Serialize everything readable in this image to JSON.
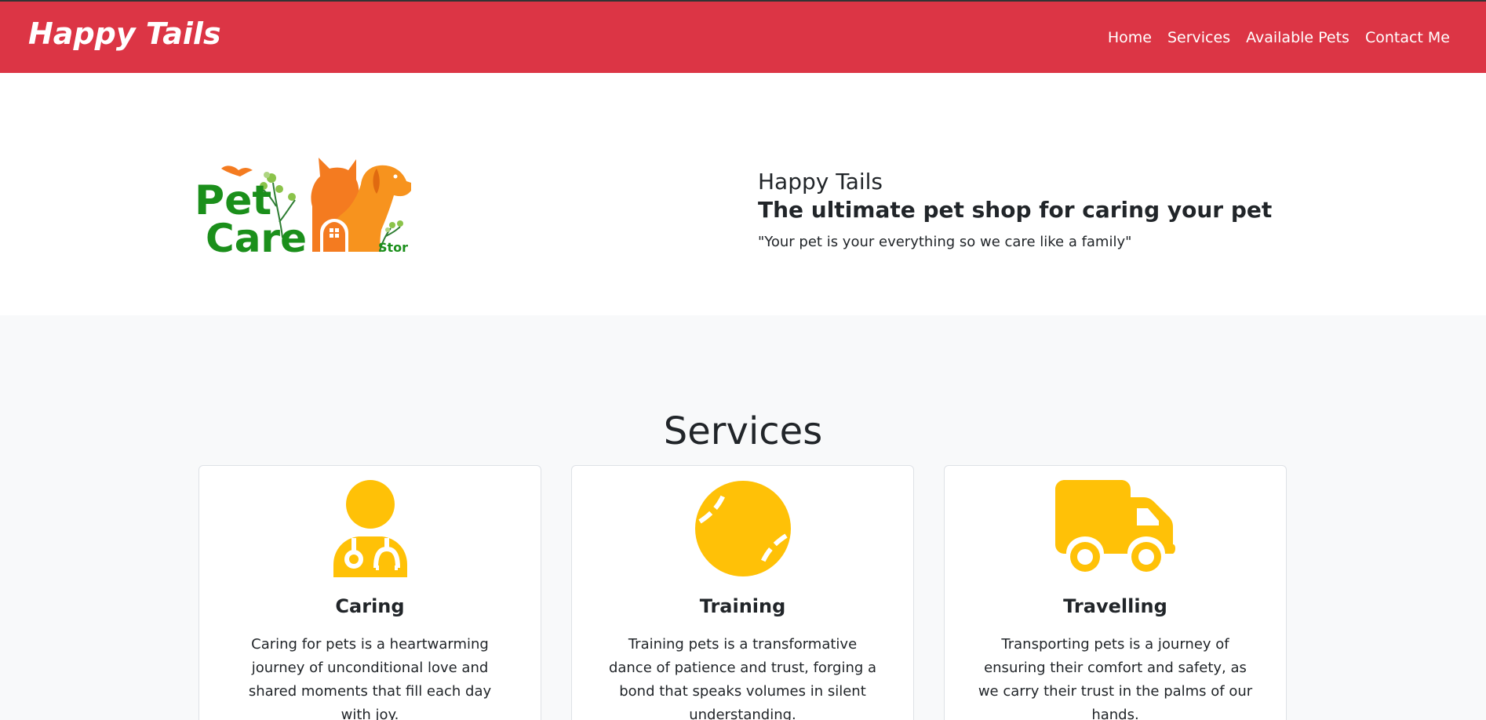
{
  "navbar": {
    "brand": "Happy Tails",
    "links": [
      "Home",
      "Services",
      "Available Pets",
      "Contact Me"
    ],
    "color": "#dc3545"
  },
  "hero": {
    "logo": {
      "line1": "Pet",
      "line2": "Care",
      "suffix": "Stor"
    },
    "title": "Happy Tails",
    "subtitle": "The ultimate pet shop for caring your pet",
    "quote": "\"Your pet is your everything so we care like a family\""
  },
  "services": {
    "heading": "Services",
    "icon_color": "#ffc107",
    "cards": [
      {
        "icon": "doctor-stethoscope-icon",
        "title": "Caring",
        "text": "Caring for pets is a heartwarming journey of unconditional love and shared moments that fill each day with joy."
      },
      {
        "icon": "ball-icon",
        "title": "Training",
        "text": "Training pets is a transformative dance of patience and trust, forging a bond that speaks volumes in silent understanding."
      },
      {
        "icon": "truck-icon",
        "title": "Travelling",
        "text": "Transporting pets is a journey of ensuring their comfort and safety, as we carry their trust in the palms of our hands."
      }
    ]
  }
}
